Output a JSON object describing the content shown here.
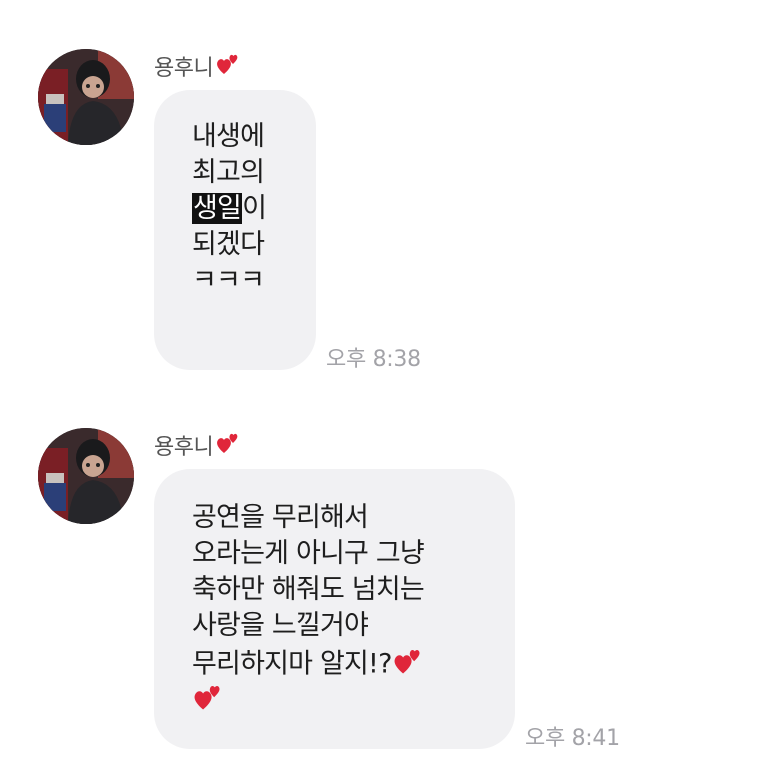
{
  "messages": [
    {
      "sender": "용후니",
      "sender_heart_icon": "two-hearts-icon",
      "lines": [
        "내생에",
        "최고의",
        "생일이",
        "되겠다",
        "ㅋㅋㅋ"
      ],
      "highlighted_text": "생일",
      "time": "오후 8:38"
    },
    {
      "sender": "용후니",
      "sender_heart_icon": "two-hearts-icon",
      "lines": [
        "공연을 무리해서",
        "오라는게 아니구 그냥",
        "축하만 해줘도 넘치는",
        "사랑을 느낄거야",
        "무리하지마 알지!?"
      ],
      "trailing_emoji": "two-hearts-icon",
      "time": "오후 8:41"
    }
  ],
  "colors": {
    "bubble": "#f1f1f3",
    "time": "#a3a3a8",
    "sender": "#555555",
    "heart": "#e0263a"
  }
}
